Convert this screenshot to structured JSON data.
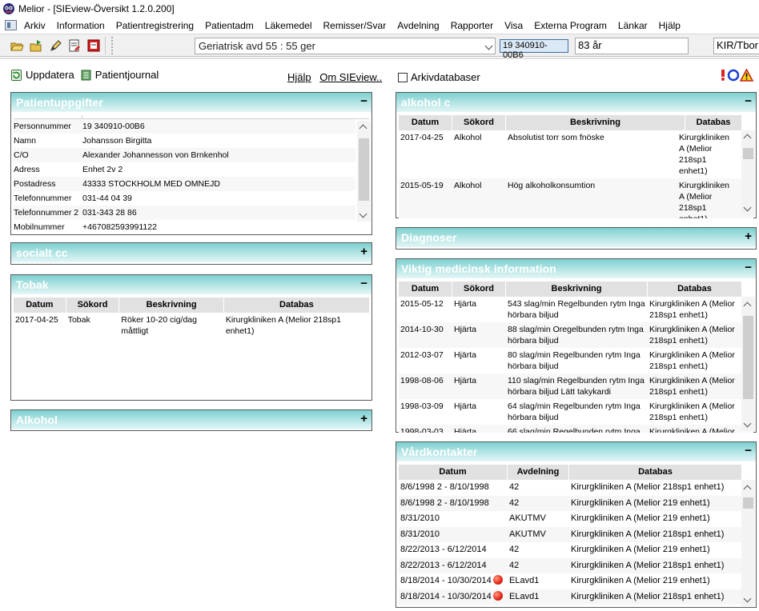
{
  "window": {
    "title": "Melior - [SIEview-Översikt 1.2.0.200]"
  },
  "menu": [
    "Arkiv",
    "Information",
    "Patientregistrering",
    "Patientadm",
    "Läkemedel",
    "Remisser/Svar",
    "Avdelning",
    "Rapporter",
    "Visa",
    "Externa Program",
    "Länkar",
    "Hjälp"
  ],
  "toolbar": {
    "ward": "Geriatrisk avd 55 : 55 ger",
    "personnummer": "19 340910-00B6",
    "age": "83 år",
    "unit": "KIR/Tbor"
  },
  "actions": {
    "update": "Uppdatera",
    "journal": "Patientjournal",
    "help": "Hjälp",
    "about": "Om SIEview..",
    "archive": "Arkivdatabaser"
  },
  "colors": {
    "panel_header_top": "#7ccfcf",
    "panel_header_bottom": "#e4f6f6",
    "grid_header": "#e1e1e1",
    "accent_blue": "#3a6fa8"
  },
  "patient": {
    "title": "Patientuppgifter",
    "toggle": "−",
    "rows": [
      {
        "label": "Personnummer",
        "value": "19 340910-00B6"
      },
      {
        "label": "Namn",
        "value": "Johansson Birgitta"
      },
      {
        "label": "C/O",
        "value": "Alexander Johannesson von Brnkenhol"
      },
      {
        "label": "Adress",
        "value": "Enhet 2v 2"
      },
      {
        "label": "Postadress",
        "value": "43333 STOCKHOLM MED OMNEJD"
      },
      {
        "label": "Telefonnummer",
        "value": "031-44 04 39"
      },
      {
        "label": "Telefonnummer 2",
        "value": "031-343 28 86"
      },
      {
        "label": "Mobilnummer",
        "value": "+467082593991122"
      }
    ]
  },
  "social": {
    "title": "socialt cc",
    "toggle": "+"
  },
  "tobak": {
    "title": "Tobak",
    "toggle": "−",
    "columns": [
      "Datum",
      "Sökord",
      "Beskrivning",
      "Databas"
    ],
    "rows": [
      {
        "datum": "2017-04-25",
        "sokord": "Tobak",
        "beskrivning": "Röker 10-20 cig/dag måttligt",
        "databas": "Kirurgkliniken A (Melior 218sp1 enhet1)"
      }
    ]
  },
  "alkohol": {
    "title": "Alkohol",
    "toggle": "+"
  },
  "alkohol_c": {
    "title": "alkohol c",
    "toggle": "−",
    "columns": [
      "Datum",
      "Sökord",
      "Beskrivning",
      "Databas"
    ],
    "rows": [
      {
        "datum": "2017-04-25",
        "sokord": "Alkohol",
        "beskrivning": "Absolutist torr som fnöske",
        "databas": "Kirurgkliniken A (Melior 218sp1 enhet1)"
      },
      {
        "datum": "2015-05-19",
        "sokord": "Alkohol",
        "beskrivning": "Hög alkoholkonsumtion",
        "databas": "Kirurgkliniken A (Melior 218sp1 enhet1)"
      }
    ]
  },
  "diagnoser": {
    "title": "Diagnoser",
    "toggle": "+"
  },
  "medinfo": {
    "title": "Viktig medicinsk information",
    "toggle": "−",
    "columns": [
      "Datum",
      "Sökord",
      "Beskrivning",
      "Databas"
    ],
    "rows": [
      {
        "datum": "2015-05-12",
        "sokord": "Hjärta",
        "beskrivning": "543 slag/min Regelbunden rytm Inga hörbara biljud",
        "databas": "Kirurgkliniken A (Melior 218sp1 enhet1)"
      },
      {
        "datum": "2014-10-30",
        "sokord": "Hjärta",
        "beskrivning": "88 slag/min Oregelbunden rytm Inga hörbara biljud",
        "databas": "Kirurgkliniken A (Melior 218sp1 enhet1)"
      },
      {
        "datum": "2012-03-07",
        "sokord": "Hjärta",
        "beskrivning": "80 slag/min Regelbunden rytm Inga hörbara biljud",
        "databas": "Kirurgkliniken A (Melior 218sp1 enhet1)"
      },
      {
        "datum": "1998-08-06",
        "sokord": "Hjärta",
        "beskrivning": "110 slag/min Regelbunden rytm Inga hörbara biljud Lätt takykardi",
        "databas": "Kirurgkliniken A (Melior 218sp1 enhet1)"
      },
      {
        "datum": "1998-03-09",
        "sokord": "Hjärta",
        "beskrivning": "64 slag/min Regelbunden rytm Inga hörbara biljud",
        "databas": "Kirurgkliniken A (Melior 218sp1 enhet1)"
      },
      {
        "datum": "1998-03-03",
        "sokord": "Hjärta",
        "beskrivning": "66 slag/min Regelbunden rytm Inga",
        "databas": "Kirurgkliniken A (Melior"
      }
    ]
  },
  "vardkontakter": {
    "title": "Vårdkontakter",
    "toggle": "−",
    "columns": [
      "Datum",
      "Avdelning",
      "Databas"
    ],
    "rows": [
      {
        "datum": "8/6/1998 2 - 8/10/1998",
        "avdelning": "42",
        "databas": "Kirurgkliniken A (Melior 218sp1 enhet1)",
        "flag": false
      },
      {
        "datum": "8/6/1998 2 - 8/10/1998",
        "avdelning": "42",
        "databas": "Kirurgkliniken A (Melior 219 enhet1)",
        "flag": false
      },
      {
        "datum": "8/31/2010",
        "avdelning": "AKUTMV",
        "databas": "Kirurgkliniken A (Melior 219 enhet1)",
        "flag": false
      },
      {
        "datum": "8/31/2010",
        "avdelning": "AKUTMV",
        "databas": "Kirurgkliniken A (Melior 218sp1 enhet1)",
        "flag": false
      },
      {
        "datum": "8/22/2013 - 6/12/2014",
        "avdelning": "42",
        "databas": "Kirurgkliniken A (Melior 219 enhet1)",
        "flag": false
      },
      {
        "datum": "8/22/2013 - 6/12/2014",
        "avdelning": "42",
        "databas": "Kirurgkliniken A (Melior 218sp1 enhet1)",
        "flag": false
      },
      {
        "datum": "8/18/2014 - 10/30/2014",
        "avdelning": "ELavd1",
        "databas": "Kirurgkliniken A (Melior 219 enhet1)",
        "flag": true
      },
      {
        "datum": "8/18/2014 - 10/30/2014",
        "avdelning": "ELavd1",
        "databas": "Kirurgkliniken A (Melior 218sp1 enhet1)",
        "flag": true
      }
    ]
  }
}
